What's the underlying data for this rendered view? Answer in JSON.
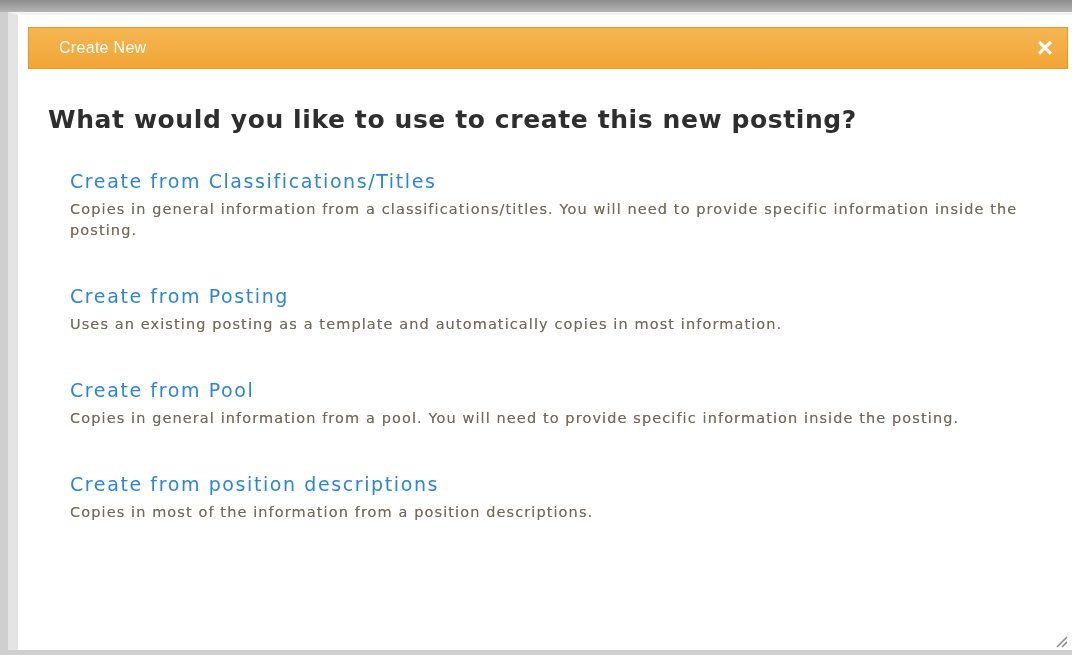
{
  "dialog": {
    "title": "Create New",
    "close": "×",
    "heading": "What would you like to use to create this new posting?",
    "options": [
      {
        "link": "Create from Classifications/Titles",
        "description": "Copies in general information from a classifications/titles. You will need to provide specific information inside the posting."
      },
      {
        "link": "Create from Posting",
        "description": "Uses an existing posting as a template and automatically copies in most information."
      },
      {
        "link": "Create from Pool",
        "description": "Copies in general information from a pool. You will need to provide specific information inside the posting."
      },
      {
        "link": "Create from position descriptions",
        "description": "Copies in most of the information from a position descriptions."
      }
    ]
  }
}
